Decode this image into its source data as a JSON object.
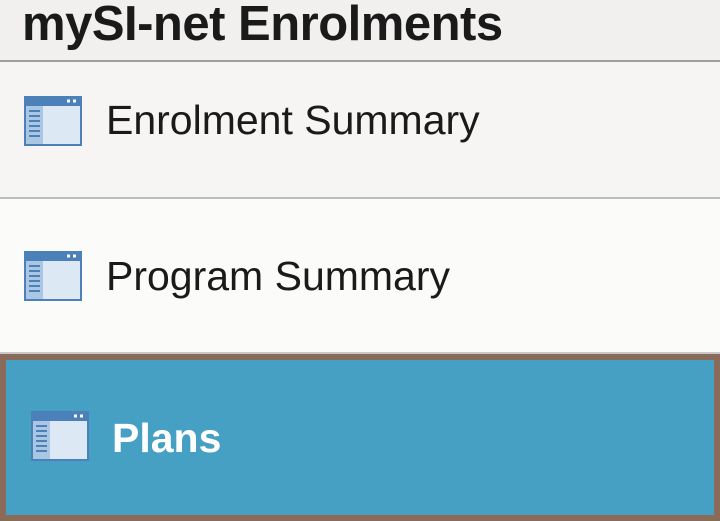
{
  "header": {
    "title": "mySI-net Enrolments"
  },
  "nav": {
    "items": [
      {
        "label": "Enrolment Summary",
        "icon": "window-page-icon",
        "selected": false
      },
      {
        "label": "Program Summary",
        "icon": "window-page-icon",
        "selected": false
      },
      {
        "label": "Plans",
        "icon": "window-page-icon",
        "selected": true
      }
    ]
  },
  "colors": {
    "selected_background": "#45a0c4",
    "selected_border": "#8a6a58",
    "icon_blue": "#4b80b8",
    "icon_fill": "#dce9f5"
  }
}
